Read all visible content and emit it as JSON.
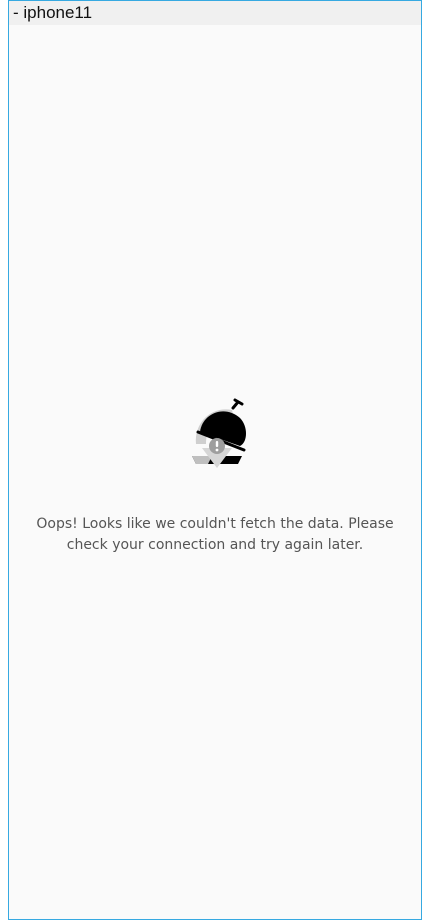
{
  "window": {
    "title": "- iphone11"
  },
  "empty_state": {
    "illustration_icon": "serving-cloche-error-icon",
    "message": "Oops! Looks like we couldn't fetch the data. Please check your connection and try again later."
  },
  "colors": {
    "frame_border": "#36a9e1",
    "background": "#fafafa",
    "titlebar": "#f0f0f0",
    "text": "#555555"
  }
}
